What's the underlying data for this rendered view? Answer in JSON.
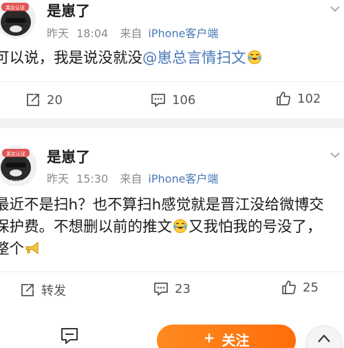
{
  "posts": [
    {
      "avatar_badge": "美女认证",
      "username": "是崽了",
      "date": "昨天",
      "time": "18:04",
      "source_prefix": "来自",
      "device": "iPhone客户端",
      "text_before": "可以说，我是说没就没",
      "mention": "@崽总言情扫文",
      "emoji": "laughing-tears-emoji",
      "repost_count": "20",
      "comment_count": "106",
      "like_count": "102"
    },
    {
      "avatar_badge": "美女认证",
      "avatar_caption": "我好美",
      "username": "是崽了",
      "date": "昨天",
      "time": "15:30",
      "source_prefix": "来自",
      "device": "iPhone客户端",
      "line1": "最近不是扫h？也不算扫h感觉就是晋江没给微博交",
      "line2_a": "保护费。不想删以前的推文",
      "line2_b": "又我怕我的号没了，",
      "line3": "整个",
      "repost_label": "转发",
      "comment_count": "23",
      "like_count": "25"
    }
  ],
  "bottom_bar": {
    "comment_icon": "comment-icon",
    "follow_plus": "+",
    "follow_label": "关注",
    "back_to_top_icon": "chevron-up-icon"
  },
  "colors": {
    "link": "#4a78b8",
    "follow_button": "#ff7a12",
    "meta": "#8a8a8a"
  }
}
